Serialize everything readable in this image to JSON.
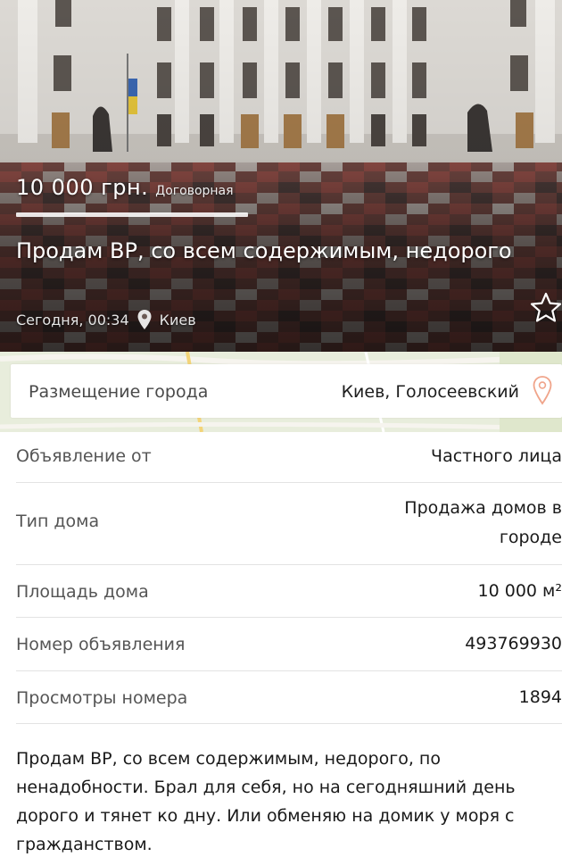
{
  "listing": {
    "price": "10 000 грн.",
    "price_note": "Договорная",
    "title": "Продам ВР, со всем содержимым, недорого",
    "posted_time": "Сегодня, 00:34",
    "city": "Киев",
    "photo_subject": "verkhovna-rada-building",
    "favorite_icon": "star-outline-icon"
  },
  "location": {
    "label": "Размещение города",
    "value": "Киев, Голосеевский",
    "icon": "map-pin-outline-icon",
    "icon_color": "#f0a48a"
  },
  "details": [
    {
      "label": "Объявление от",
      "value": "Частного лица"
    },
    {
      "label": "Тип дома",
      "value": "Продажа домов в городе"
    },
    {
      "label": "Площадь дома",
      "value": "10 000 м²"
    },
    {
      "label": "Номер объявления",
      "value": "493769930"
    },
    {
      "label": "Просмотры номера",
      "value": "1894"
    }
  ],
  "description": "Продам ВР, со всем содержимым, недорого, по ненадобности. Брал для себя, но на сегодняшний день дорого и тянет ко дну. Или обменяю на домик у моря с гражданством.",
  "colors": {
    "divider": "#e3e3e3",
    "map_bg": "#e8eddc"
  }
}
